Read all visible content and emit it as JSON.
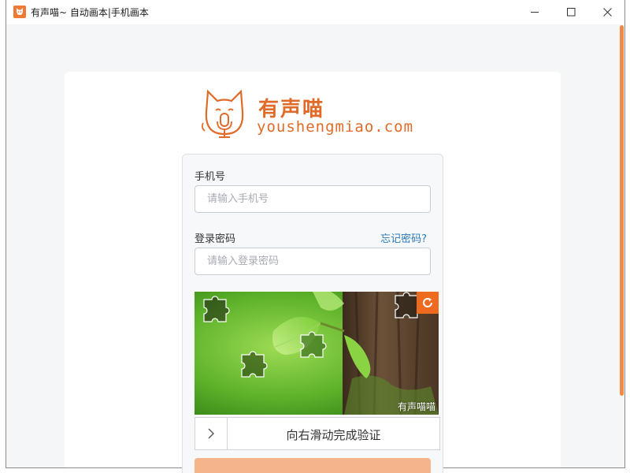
{
  "window": {
    "title": "有声喵~ 自动画本|手机画本",
    "icon": "cat-app-icon",
    "controls": [
      "minimize-icon",
      "maximize-icon",
      "close-icon"
    ]
  },
  "brand": {
    "name_cn": "有声喵",
    "domain": "youshengmiao.com",
    "color": "#e06b28"
  },
  "form": {
    "phone": {
      "label": "手机号",
      "placeholder": "请输入手机号",
      "value": ""
    },
    "password": {
      "label": "登录密码",
      "placeholder": "请输入登录密码",
      "value": ""
    },
    "forgot_link": "忘记密码?"
  },
  "captcha": {
    "watermark": "有声喵喵",
    "refresh_icon": "refresh-icon",
    "accent": "#ee6a1e"
  },
  "slider": {
    "text": "向右滑动完成验证",
    "handle_icon": "chevron-right-icon",
    "progress": 0
  },
  "login_button": {
    "color": "#f5b48a"
  },
  "scrollbar": {
    "color": "#ef8a48"
  }
}
